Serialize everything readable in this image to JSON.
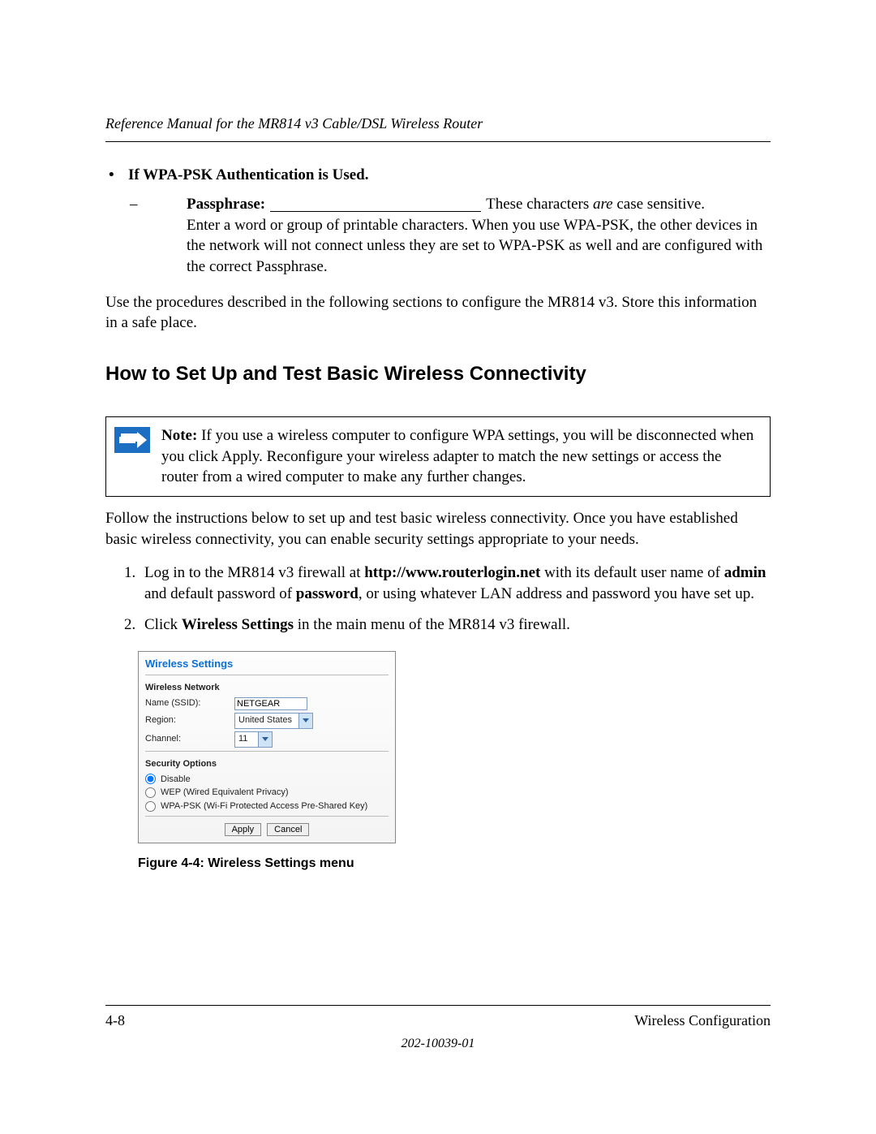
{
  "running_head": "Reference Manual for the MR814 v3 Cable/DSL Wireless Router",
  "bullet": {
    "dot": "•",
    "heading": "If WPA-PSK Authentication is Used."
  },
  "passphrase": {
    "dash": "–",
    "label": "Passphrase",
    "colon": ":",
    "tail_plain1": "These characters ",
    "tail_italic": "are",
    "tail_plain2": " case sensitive.",
    "body": "Enter a word or group of printable characters. When you use WPA-PSK, the other devices in the network will not connect unless they are set to WPA-PSK as well and are configured with the correct Passphrase."
  },
  "use_para": "Use the procedures described in the following sections to configure the MR814 v3. Store this information in a safe place.",
  "section_title": "How to Set Up and Test Basic Wireless Connectivity",
  "note": {
    "lead": "Note:",
    "body": " If you use a wireless computer to configure WPA settings, you will be disconnected when you click Apply. Reconfigure your wireless adapter to match the new settings or access the router from a wired computer to make any further changes."
  },
  "follow_para": "Follow the instructions below to set up and test basic wireless connectivity. Once you have established basic wireless connectivity, you can enable security settings appropriate to your needs.",
  "steps": {
    "s1": {
      "a": "Log in to the MR814 v3 firewall at ",
      "url": "http://www.routerlogin.net",
      "b": " with its default user name of ",
      "user": "admin",
      "c": " and default password of ",
      "pass": "password",
      "d": ", or using whatever LAN address and password you have set up."
    },
    "s2": {
      "a": "Click ",
      "bold": "Wireless Settings",
      "b": " in the main menu of the MR814 v3 firewall."
    }
  },
  "panel": {
    "title": "Wireless Settings",
    "grp1": "Wireless Network",
    "name_label": "Name (SSID):",
    "name_value": "NETGEAR",
    "region_label": "Region:",
    "region_value": "United States",
    "channel_label": "Channel:",
    "channel_value": "11",
    "grp2": "Security Options",
    "opt_disable": "Disable",
    "opt_wep": "WEP (Wired Equivalent Privacy)",
    "opt_wpa": "WPA-PSK (Wi-Fi Protected Access Pre-Shared Key)",
    "btn_apply": "Apply",
    "btn_cancel": "Cancel"
  },
  "fig_caption": "Figure 4-4:  Wireless Settings menu",
  "footer": {
    "left": "4-8",
    "right": "Wireless Configuration",
    "docnum": "202-10039-01"
  }
}
